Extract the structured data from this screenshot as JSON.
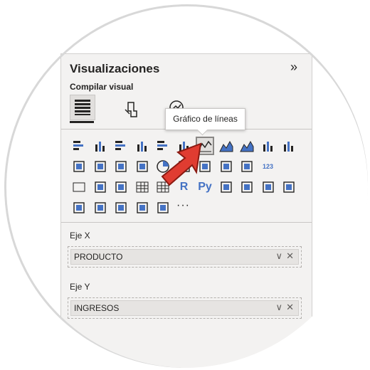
{
  "panel": {
    "title": "Visualizaciones",
    "collapse_icon": "»",
    "subtitle": "Compilar visual",
    "tooltip": "Gráfico de líneas",
    "more_label": "···"
  },
  "icons": [
    "stacked-bar-icon",
    "stacked-column-icon",
    "clustered-bar-icon",
    "clustered-column-icon",
    "100-stacked-bar-icon",
    "100-stacked-column-icon",
    "line-chart-icon",
    "area-chart-icon",
    "stacked-area-icon",
    "line-column-icon",
    "line-clustered-column-icon",
    "ribbon-chart-icon",
    "waterfall-icon",
    "funnel-icon",
    "scatter-icon",
    "pie-icon",
    "treemap-icon",
    "map-icon",
    "filled-map-icon",
    "gauge-icon",
    "card-icon",
    "multirow-card-icon",
    "kpi-icon",
    "slicer-icon",
    "table-icon",
    "matrix-icon",
    "r-visual-icon",
    "python-visual-icon",
    "key-influencers-icon",
    "decomposition-tree-icon",
    "qa-icon",
    "narrative-icon",
    "goals-icon",
    "paginated-report-icon",
    "power-apps-icon",
    "power-automate-icon",
    "arcgis-icon"
  ],
  "r_label": "R",
  "py_label": "Py",
  "card_label": "123",
  "wells": {
    "x_label": "Eje X",
    "x_value": "PRODUCTO",
    "y_label": "Eje Y",
    "y_value": "INGRESOS",
    "chevron": "∨",
    "remove": "✕"
  },
  "colors": {
    "accent": "#4472c4",
    "selected_outline": "#8a8886",
    "arrow": "#e03c31"
  }
}
